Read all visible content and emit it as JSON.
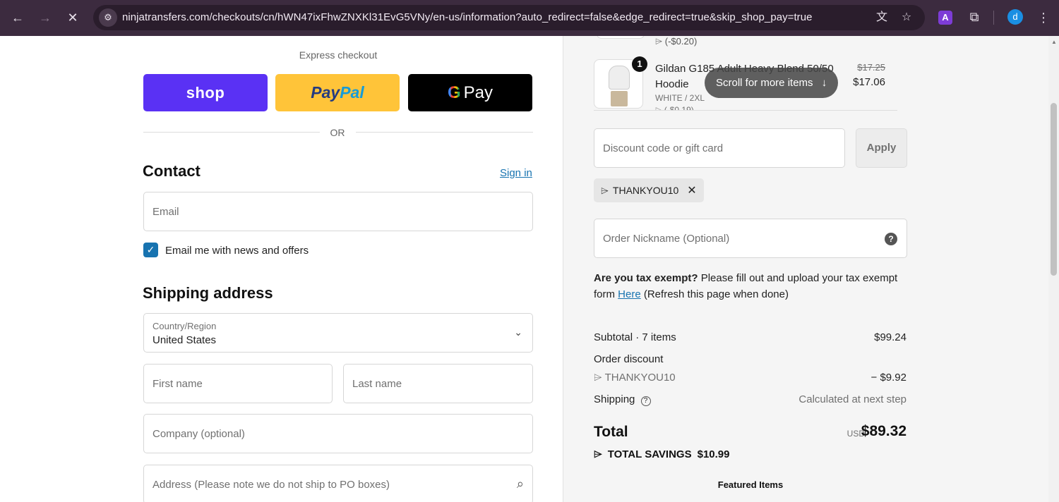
{
  "browser": {
    "url": "ninjatransfers.com/checkouts/cn/hWN47ixFhwZNXKl31EvG5VNy/en-us/information?auto_redirect=false&edge_redirect=true&skip_shop_pay=true",
    "profile_initial": "d",
    "ext_letter": "A"
  },
  "express": {
    "label": "Express checkout",
    "shop_label": "shop",
    "paypal_a": "Pay",
    "paypal_b": "Pal",
    "gpay_g": "G",
    "gpay_label": "Pay",
    "or_label": "OR"
  },
  "contact": {
    "title": "Contact",
    "sign_in": "Sign in",
    "email_placeholder": "Email",
    "newsletter_label": "Email me with news and offers",
    "newsletter_checked": true
  },
  "shipping": {
    "title": "Shipping address",
    "country_label": "Country/Region",
    "country_value": "United States",
    "first_name_placeholder": "First name",
    "last_name_placeholder": "Last name",
    "company_placeholder": "Company (optional)",
    "address_placeholder": "Address (Please note we do not ship to PO boxes)"
  },
  "order": {
    "prev_item_discount": "(-$0.20)",
    "item": {
      "quantity": "1",
      "name": "Gildan G185 Adult Heavy Blend 50/50 Hoodie",
      "variant": "WHITE / 2XL",
      "discount": "(-$0.19)",
      "price_old": "$17.25",
      "price_new": "$17.06"
    },
    "scroll_hint": "Scroll for more items",
    "discount_placeholder": "Discount code or gift card",
    "apply_label": "Apply",
    "applied_code": "THANKYOU10",
    "nickname_placeholder": "Order Nickname (Optional)",
    "tax_bold": "Are you tax exempt?",
    "tax_text": " Please fill out and upload your tax exempt form ",
    "tax_link": "Here",
    "tax_tail": " (Refresh this page when done)",
    "subtotal_label": "Subtotal · 7 items",
    "subtotal_value": "$99.24",
    "order_discount_label": "Order discount",
    "discount_code_label": "THANKYOU10",
    "discount_value": "− $9.92",
    "shipping_label": "Shipping",
    "shipping_value": "Calculated at next step",
    "total_label": "Total",
    "total_currency": "USD",
    "total_value": "$89.32",
    "savings_label": "TOTAL SAVINGS",
    "savings_value": "$10.99",
    "featured_label": "Featured Items"
  },
  "colors": {
    "shop": "#5a31f4",
    "paypal": "#ffc439",
    "link": "#1773b0",
    "chrome": "#3c2b3f"
  }
}
